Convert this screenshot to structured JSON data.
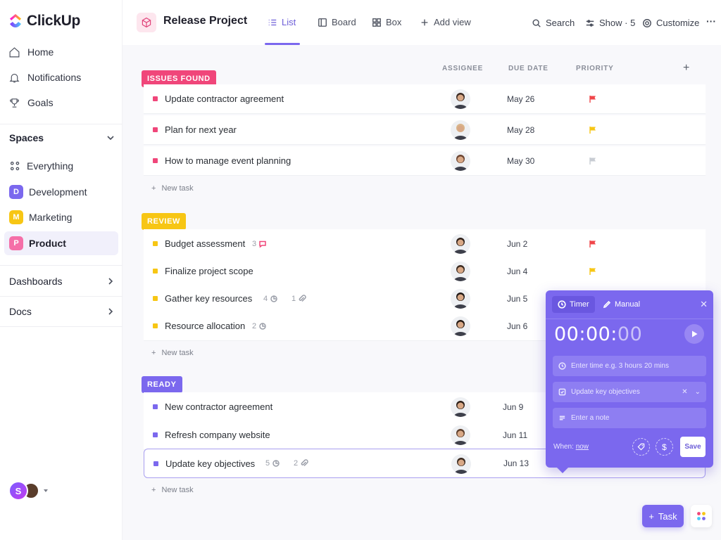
{
  "app": {
    "name": "ClickUp"
  },
  "sidebar": {
    "nav": [
      {
        "label": "Home",
        "icon": "home-icon"
      },
      {
        "label": "Notifications",
        "icon": "bell-icon"
      },
      {
        "label": "Goals",
        "icon": "trophy-icon"
      }
    ],
    "spaces_title": "Spaces",
    "spaces": [
      {
        "label": "Everything",
        "badge": "",
        "color": ""
      },
      {
        "label": "Development",
        "badge": "D",
        "color": "#7b68ee"
      },
      {
        "label": "Marketing",
        "badge": "M",
        "color": "#f7c614"
      },
      {
        "label": "Product",
        "badge": "P",
        "color": "#f56fa8",
        "active": true
      }
    ],
    "dashboards": "Dashboards",
    "docs": "Docs",
    "user": {
      "initial": "S"
    }
  },
  "header": {
    "project_title": "Release Project",
    "views": [
      {
        "label": "List",
        "icon": "list-icon",
        "active": true
      },
      {
        "label": "Board",
        "icon": "board-icon"
      },
      {
        "label": "Box",
        "icon": "box-icon"
      },
      {
        "label": "Add view",
        "icon": "plus-icon"
      }
    ],
    "tools": {
      "search": "Search",
      "show": "Show · 5",
      "customize": "Customize",
      "more": "···"
    }
  },
  "columns": {
    "assignee": "ASSIGNEE",
    "due": "DUE DATE",
    "priority": "PRIORITY",
    "add": "+"
  },
  "groups": [
    {
      "label": "ISSUES FOUND",
      "color": "#f0467a",
      "tasks": [
        {
          "name": "Update contractor agreement",
          "due": "May 26",
          "priority": "urgent"
        },
        {
          "name": "Plan for next year",
          "due": "May 28",
          "priority": "high"
        },
        {
          "name": "How to manage event planning",
          "due": "May 30",
          "priority": "none"
        }
      ]
    },
    {
      "label": "REVIEW",
      "color": "#f7c614",
      "tasks": [
        {
          "name": "Budget assessment",
          "due": "Jun 2",
          "priority": "urgent",
          "meta": [
            {
              "count": "3",
              "icon": "comment-icon"
            }
          ]
        },
        {
          "name": "Finalize project scope",
          "due": "Jun 4",
          "priority": "high"
        },
        {
          "name": "Gather key resources",
          "due": "Jun 5",
          "priority": "",
          "meta": [
            {
              "count": "4",
              "icon": "subtask-icon"
            },
            {
              "count": "1",
              "icon": "attachment-icon"
            }
          ]
        },
        {
          "name": "Resource allocation",
          "due": "Jun 6",
          "priority": "",
          "meta": [
            {
              "count": "2",
              "icon": "subtask-icon"
            }
          ]
        }
      ]
    },
    {
      "label": "READY",
      "color": "#7b68ee",
      "tasks": [
        {
          "name": "New contractor agreement",
          "due": "Jun 9",
          "priority": ""
        },
        {
          "name": "Refresh company website",
          "due": "Jun 11",
          "priority": ""
        },
        {
          "name": "Update key objectives",
          "due": "Jun 13",
          "priority": "",
          "selected": true,
          "meta": [
            {
              "count": "5",
              "icon": "subtask-icon"
            },
            {
              "count": "2",
              "icon": "attachment-icon"
            }
          ]
        }
      ]
    }
  ],
  "new_task_label": "New task",
  "timer": {
    "tabs": [
      {
        "label": "Timer",
        "icon": "clock-icon"
      },
      {
        "label": "Manual",
        "icon": "edit-icon"
      }
    ],
    "clock_main": "00:00:",
    "clock_dim": "00",
    "time_placeholder": "Enter time e.g. 3 hours 20 mins",
    "task_value": "Update key objectives",
    "note_placeholder": "Enter a note",
    "when_label": "When:",
    "when_value": "now",
    "save": "Save"
  },
  "fab": {
    "label": "Task"
  },
  "colors": {
    "accent": "#7b68ee",
    "urgent": "#f0464a",
    "high": "#f7c614",
    "none": "#c8ccd3"
  }
}
